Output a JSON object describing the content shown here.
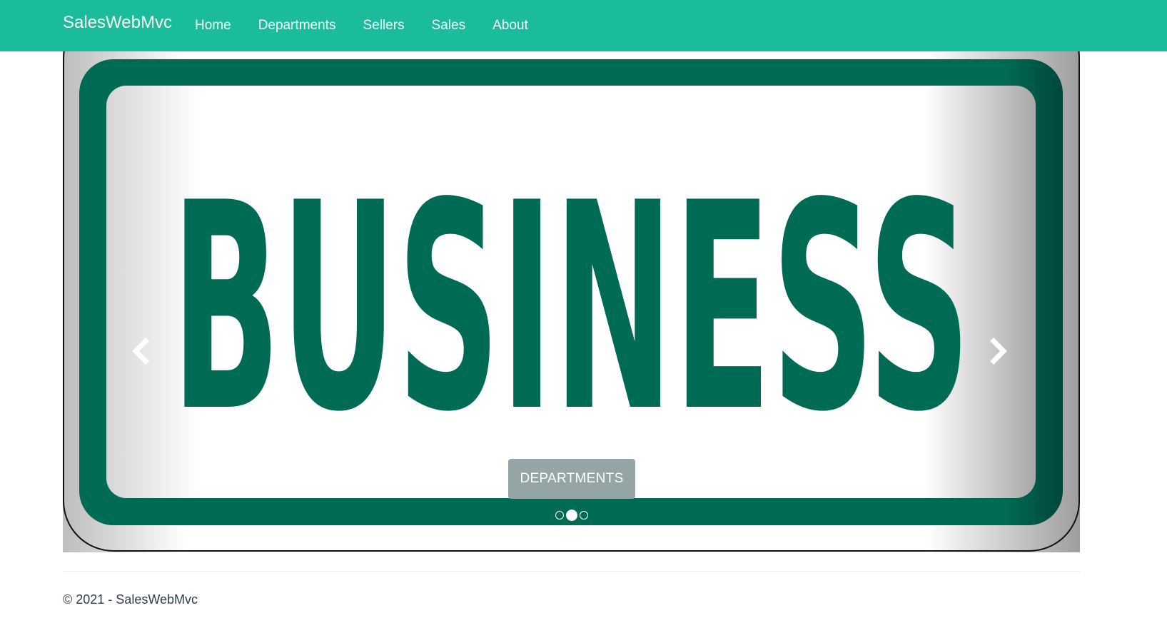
{
  "navbar": {
    "brand": "SalesWebMvc",
    "links": [
      "Home",
      "Departments",
      "Sellers",
      "Sales",
      "About"
    ],
    "color": "#1abc9c"
  },
  "carousel": {
    "slide_text": "BUSINESS",
    "caption_button": "DEPARTMENTS",
    "indicator_count": 3,
    "active_indicator": 2,
    "prev_icon": "chevron-left-icon",
    "next_icon": "chevron-right-icon",
    "sign_green": "#006b55"
  },
  "footer": {
    "text": "© 2021 - SalesWebMvc"
  }
}
